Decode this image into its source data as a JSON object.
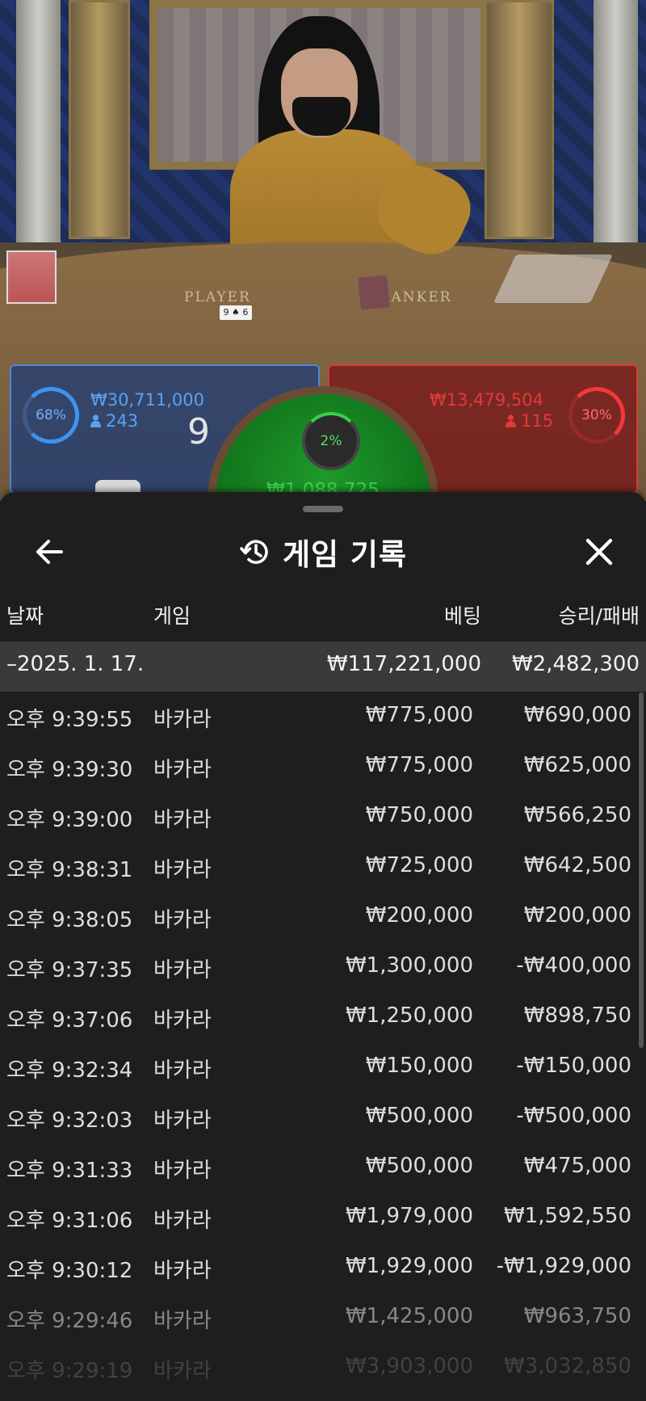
{
  "video": {
    "table_labels": {
      "player": "PLAYER",
      "banker": "BANKER"
    },
    "card_small": "9 ♠ 6"
  },
  "bets": {
    "player": {
      "percent": "68%",
      "amount": "₩30,711,000",
      "count": "243",
      "score": "9",
      "color": "#3d93f0"
    },
    "banker": {
      "percent": "30%",
      "amount": "₩13,479,504",
      "count": "115",
      "color": "#e03a3a"
    },
    "tie": {
      "percent": "2%",
      "amount": "₩1,088,725",
      "color": "#3ed04e"
    }
  },
  "sheet": {
    "title": "게임 기록",
    "icons": {
      "back": "arrow-left-icon",
      "history": "history-icon",
      "close": "close-icon"
    },
    "columns": {
      "date": "날짜",
      "game": "게임",
      "bet": "베팅",
      "result": "승리/패배"
    },
    "summary": {
      "date": "–2025. 1. 17.",
      "bet": "₩117,221,000",
      "result": "₩2,482,300"
    },
    "rows": [
      {
        "time": "오후 9:39:55",
        "game": "바카라",
        "bet": "₩775,000",
        "result": "₩690,000"
      },
      {
        "time": "오후 9:39:30",
        "game": "바카라",
        "bet": "₩775,000",
        "result": "₩625,000"
      },
      {
        "time": "오후 9:39:00",
        "game": "바카라",
        "bet": "₩750,000",
        "result": "₩566,250"
      },
      {
        "time": "오후 9:38:31",
        "game": "바카라",
        "bet": "₩725,000",
        "result": "₩642,500"
      },
      {
        "time": "오후 9:38:05",
        "game": "바카라",
        "bet": "₩200,000",
        "result": "₩200,000"
      },
      {
        "time": "오후 9:37:35",
        "game": "바카라",
        "bet": "₩1,300,000",
        "result": "-₩400,000"
      },
      {
        "time": "오후 9:37:06",
        "game": "바카라",
        "bet": "₩1,250,000",
        "result": "₩898,750"
      },
      {
        "time": "오후 9:32:34",
        "game": "바카라",
        "bet": "₩150,000",
        "result": "-₩150,000"
      },
      {
        "time": "오후 9:32:03",
        "game": "바카라",
        "bet": "₩500,000",
        "result": "-₩500,000"
      },
      {
        "time": "오후 9:31:33",
        "game": "바카라",
        "bet": "₩500,000",
        "result": "₩475,000"
      },
      {
        "time": "오후 9:31:06",
        "game": "바카라",
        "bet": "₩1,979,000",
        "result": "₩1,592,550"
      },
      {
        "time": "오후 9:30:12",
        "game": "바카라",
        "bet": "₩1,929,000",
        "result": "-₩1,929,000"
      },
      {
        "time": "오후 9:29:46",
        "game": "바카라",
        "bet": "₩1,425,000",
        "result": "₩963,750"
      },
      {
        "time": "오후 9:29:19",
        "game": "바카라",
        "bet": "₩3,903,000",
        "result": "₩3,032,850"
      }
    ]
  }
}
